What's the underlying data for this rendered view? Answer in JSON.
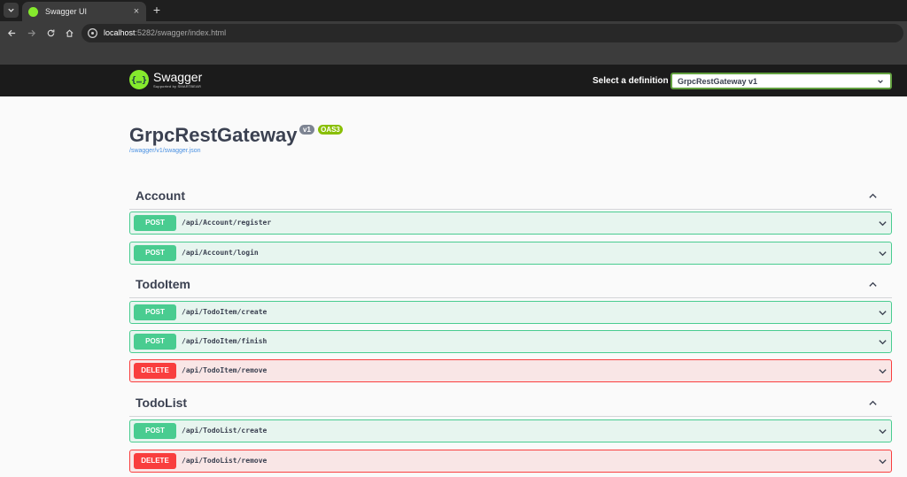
{
  "browser": {
    "tab_title": "Swagger UI",
    "tab_close": "×",
    "new_tab": "+",
    "url_host": "localhost",
    "url_rest": ":5282/swagger/index.html"
  },
  "topbar": {
    "logo_name": "Swagger",
    "logo_sub": "Supported by SMARTBEAR",
    "definition_label": "Select a definition",
    "definition_value": "GrpcRestGateway v1"
  },
  "info": {
    "title": "GrpcRestGateway",
    "version": "v1",
    "oas": "OAS3",
    "spec_url": "/swagger/v1/swagger.json"
  },
  "sections": [
    {
      "name": "Account",
      "operations": [
        {
          "method": "POST",
          "path": "/api/Account/register"
        },
        {
          "method": "POST",
          "path": "/api/Account/login"
        }
      ]
    },
    {
      "name": "TodoItem",
      "operations": [
        {
          "method": "POST",
          "path": "/api/TodoItem/create"
        },
        {
          "method": "POST",
          "path": "/api/TodoItem/finish"
        },
        {
          "method": "DELETE",
          "path": "/api/TodoItem/remove"
        }
      ]
    },
    {
      "name": "TodoList",
      "operations": [
        {
          "method": "POST",
          "path": "/api/TodoList/create"
        },
        {
          "method": "DELETE",
          "path": "/api/TodoList/remove"
        }
      ]
    }
  ],
  "colors": {
    "post": "#49cc90",
    "delete": "#f93e3e",
    "swagger_green": "#85ea2d",
    "text": "#3b4151"
  }
}
